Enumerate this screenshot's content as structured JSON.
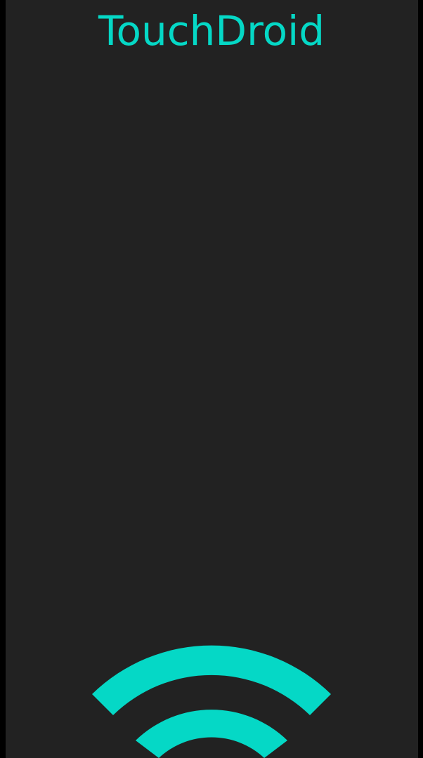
{
  "app": {
    "title": "TouchDroid"
  },
  "icon": {
    "name": "wifi-icon"
  },
  "colors": {
    "accent": "#05D8C6",
    "panel": "#222222",
    "frame": "#000000"
  }
}
